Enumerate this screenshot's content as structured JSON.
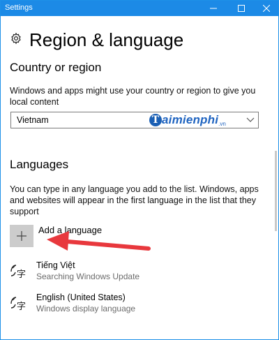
{
  "window": {
    "title": "Settings",
    "accent": "#1c8ae6"
  },
  "header": {
    "icon": "gear-icon",
    "title": "Region & language"
  },
  "country": {
    "heading": "Country or region",
    "description": "Windows and apps might use your country or region to give you local content",
    "selected_value": "Vietnam"
  },
  "watermark": {
    "logo_letter": "T",
    "text": "aimienphi",
    "suffix": ".vn"
  },
  "languages": {
    "heading": "Languages",
    "description": "You can type in any language you add to the list. Windows, apps and websites will appear in the first language in the list that they support",
    "add_label": "Add a language",
    "items": [
      {
        "name": "Tiếng Việt",
        "status": "Searching Windows Update",
        "icon": "language-icon"
      },
      {
        "name": "English (United States)",
        "status": "Windows display language",
        "icon": "language-icon"
      }
    ]
  },
  "annotation": {
    "arrow_color": "#e8383d"
  }
}
